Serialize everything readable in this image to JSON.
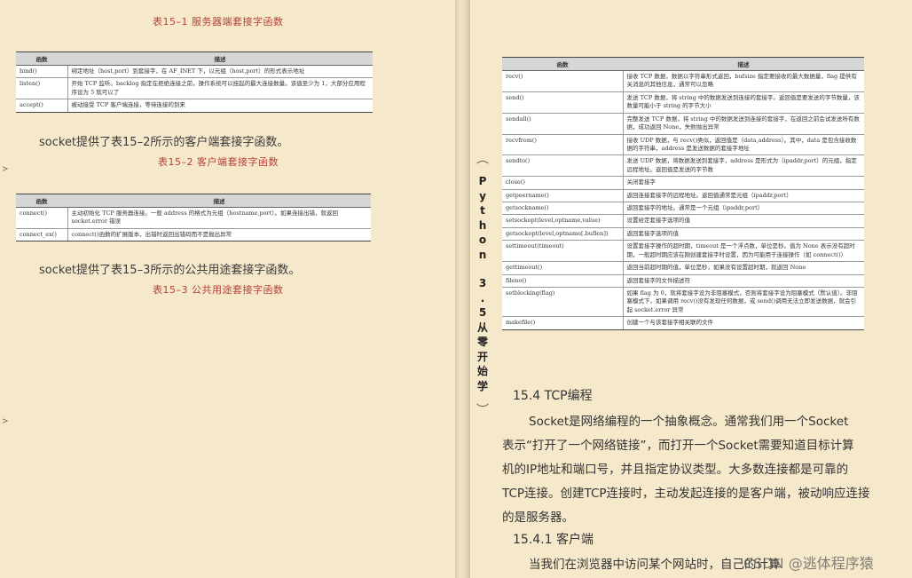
{
  "left": {
    "caption_1": "表15–1 服务器端套接字函数",
    "table_1": {
      "headers": [
        "函数",
        "描述"
      ],
      "rows": [
        [
          "bind()",
          "绑定地址（host,port）到套接字，在 AF_INET 下，以元组（host,port）的形式表示地址"
        ],
        [
          "listen()",
          "开始 TCP 监听。backlog 指定在拒绝连接之前，操作系统可以挂起的最大连接数量。该值至少为 1，大部分应用程序设为 5 就可以了"
        ],
        [
          "accept()",
          "被动接受 TCP 客户端连接，等待连接的到来"
        ]
      ]
    },
    "para_1": "socket提供了表15–2所示的客户端套接字函数。",
    "caption_2": "表15–2 客户端套接字函数",
    "table_2": {
      "headers": [
        "函数",
        "描述"
      ],
      "rows": [
        [
          "connect()",
          "主动初始化 TCP 服务器连接。一般 address 的格式为元组（hostname,port）。如果连接出错，就返回 socket.error 错误"
        ],
        [
          "connect_ex()",
          "connect()函数的扩展版本，出错时返回出错码而不是抛出异常"
        ]
      ]
    },
    "para_2": "socket提供了表15–3所示的公共用途套接字函数。",
    "caption_3": "表15–3 公共用途套接字函数",
    "edge_marks": [
      ">",
      ">"
    ]
  },
  "spine": {
    "ornament_top": "⌒",
    "chars": [
      "P",
      "y",
      "t",
      "h",
      "o",
      "n",
      "",
      "3",
      ".",
      "5",
      "从",
      "零",
      "开",
      "始",
      "学"
    ],
    "ornament_bottom": "⌒"
  },
  "right": {
    "table_3": {
      "headers": [
        "函数",
        "描述"
      ],
      "rows": [
        [
          "recv()",
          "接收 TCP 数据，数据以字符串形式返回，bufsize 指定要接收的最大数据量，flag 提供有关消息的其他信息，通常可以忽略"
        ],
        [
          "send()",
          "发送 TCP 数据，将 string 中的数据发送到连接的套接字。返回值是要发送的字节数量，该数量可能小于 string 的字节大小"
        ],
        [
          "sendall()",
          "完整发送 TCP 数据，将 string 中的数据发送到连接的套接字，在返回之前会试发送所有数据，成功返回 None，失败抛出异常"
        ],
        [
          "recvfrom()",
          "接收 UDP 数据，与 recv()类似，返回值是（data,address）。其中，data 是包含接收数据的字符串，address 是发送数据的套接字地址"
        ],
        [
          "sendto()",
          "发送 UDP 数据，将数据发送到套接字，address 是形式为（ipaddr,port）的元组，指定远程地址。返回值是发送的字节数"
        ],
        [
          "close()",
          "关闭套接字"
        ],
        [
          "getpeername()",
          "返回连接套接字的远程地址。返回值通常是元组（ipaddr,port）"
        ],
        [
          "getsockname()",
          "返回套接字的地址。通常是一个元组（ipaddr,port）"
        ],
        [
          "setsockopt(level,optname,value)",
          "设置给定套接字选项的值"
        ],
        [
          "getsockopt(level,optname[.buflen])",
          "返回套接字选项的值"
        ],
        [
          "settimeout(timeout)",
          "设置套接字操作的超时期，timeout 是一个浮点数，单位是秒。值为 None 表示没有超时期，一般超时期应该在刚创建套接字时设置，因为可能用于连接操作（如 connect()）"
        ],
        [
          "gettimeout()",
          "返回当前超时期的值，单位是秒，如果没有设置超时期，就返回 None"
        ],
        [
          "fileno()",
          "返回套接字的文件描述符"
        ],
        [
          "setblocking(flag)",
          "如果 flag 为 0，就将套接字设为非阻塞模式，否则将套接字设为阻塞模式（默认值）。非阻塞模式下，如果调用 recv()没有发现任何数据，或 send()调用无法立即发送数据，就会引起 socket.error 异常"
        ],
        [
          "makefile()",
          "创建一个与该套接字相关联的文件"
        ]
      ]
    },
    "section_title": "15.4 TCP编程",
    "body_lines": [
      "Socket是网络编程的一个抽象概念。通常我们用一个Socket",
      "表示“打开了一个网络链接”，而打开一个Socket需要知道目标计算",
      "机的IP地址和端口号，并且指定协议类型。大多数连接都是可靠的",
      "TCP连接。创建TCP连接时，主动发起连接的是客户端，被动响应连接",
      "的是服务器。"
    ],
    "subsection_title": "15.4.1 客户端",
    "last_line": "当我们在浏览器中访问某个网站时，自己的计算"
  },
  "watermark": "CSDN @逃体程序猿"
}
